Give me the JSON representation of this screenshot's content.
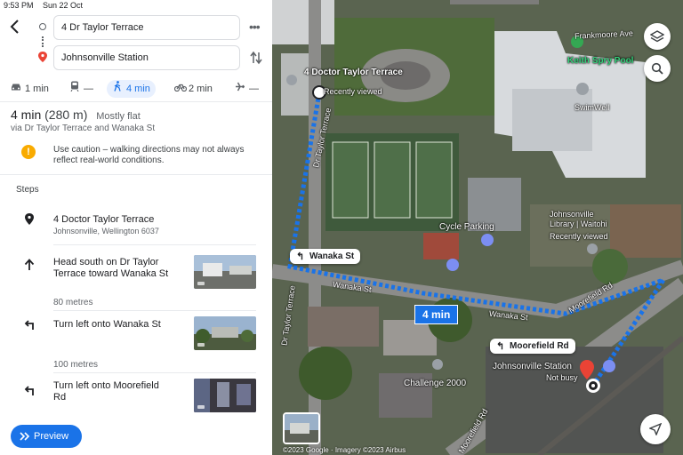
{
  "status": {
    "time": "9:53 PM",
    "date": "Sun 22 Oct",
    "wifi": "wifi-icon"
  },
  "route": {
    "origin": "4 Dr Taylor Terrace",
    "destination": "Johnsonville Station",
    "more": "•••",
    "swap_icon": "swap-icon"
  },
  "modes": [
    {
      "name": "drive",
      "icon": "car-icon",
      "value": "1 min"
    },
    {
      "name": "transit",
      "icon": "train-icon",
      "value": "—"
    },
    {
      "name": "walk",
      "icon": "walk-icon",
      "value": "4 min",
      "active": true
    },
    {
      "name": "cycle",
      "icon": "bike-icon",
      "value": "2 min"
    },
    {
      "name": "flight",
      "icon": "plane-icon",
      "value": "—"
    }
  ],
  "summary": {
    "time": "4 min",
    "distance": "(280 m)",
    "terrain": "Mostly flat",
    "via": "via Dr Taylor Terrace and Wanaka St"
  },
  "warning": "Use caution – walking directions may not always reflect real-world conditions.",
  "steps_title": "Steps",
  "steps": [
    {
      "text": "4 Doctor Taylor Terrace",
      "sub": "Johnsonville, Wellington 6037",
      "icon": "pin-icon"
    },
    {
      "text": "Head south on Dr Taylor Terrace toward Wanaka St",
      "icon": "arrow-up-icon",
      "distance": "80 metres"
    },
    {
      "text": "Turn left onto Wanaka St",
      "icon": "turn-left-icon",
      "distance": "100 metres"
    },
    {
      "text": "Turn left onto Moorefield Rd",
      "icon": "turn-left-icon"
    }
  ],
  "preview_label": "Preview",
  "map": {
    "callouts": [
      "Wanaka St",
      "Moorefield Rd"
    ],
    "time_badge": "4 min",
    "labels": {
      "doctor": "4 Doctor Taylor Terrace",
      "recent1": "Recently viewed",
      "keith": "Keith Spry Pool",
      "swimwell": "SwimWell",
      "frankmoore": "Frankmoore Ave",
      "library": "Johnsonville Library | Waitohi",
      "recent2": "Recently viewed",
      "cycle": "Cycle Parking",
      "station": "Johnsonville Station",
      "notbusy": "Not busy",
      "challenge": "Challenge 2000",
      "wanaka1": "Wanaka St",
      "wanaka2": "Wanaka St",
      "moorefield1": "Moorefield Rd",
      "moorefield2": "Moorefield Rd",
      "drtaylor1": "Dr Taylor Terrace",
      "drtaylor2": "Dr Taylor Terrace"
    },
    "copyright": "©2023 Google · Imagery ©2023 Airbus"
  },
  "colors": {
    "route": "#1a73e8",
    "accent": "#1a73e8",
    "warning": "#f9ab00",
    "pin": "#ea4335"
  }
}
